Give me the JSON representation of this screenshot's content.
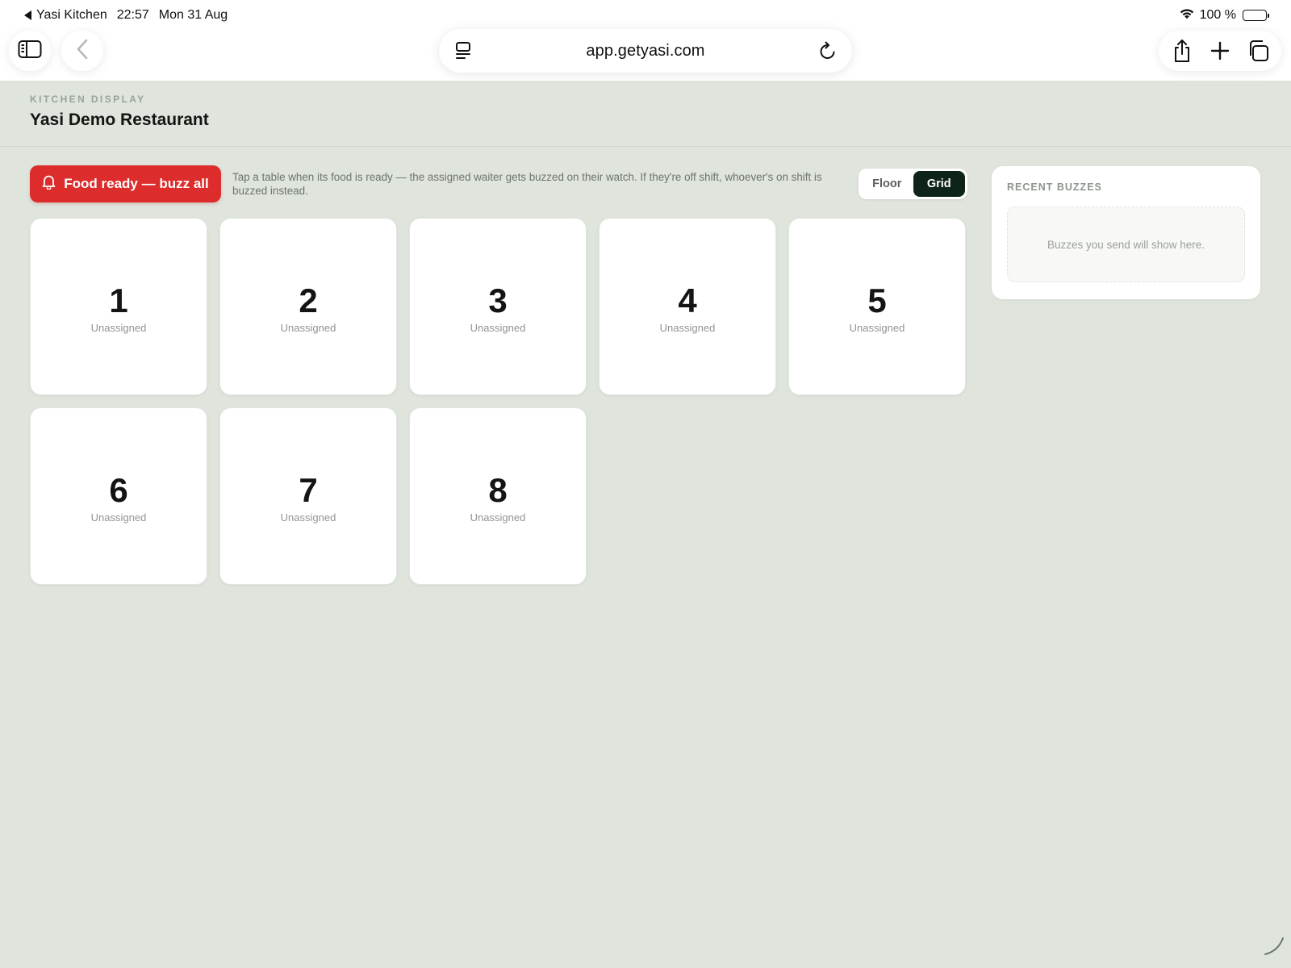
{
  "status_bar": {
    "back_app": "Yasi Kitchen",
    "time": "22:57",
    "date": "Mon 31 Aug",
    "battery": "100 %",
    "battery_level": 1.0
  },
  "browser": {
    "url": "app.getyasi.com",
    "icons": {
      "sidebar": "sidebar-icon",
      "back": "chevron-left-icon",
      "reader": "reader-icon",
      "reload": "reload-icon",
      "share": "share-icon",
      "new_tab": "plus-icon",
      "tabs": "tabs-icon"
    }
  },
  "header": {
    "eyebrow": "KITCHEN DISPLAY",
    "title": "Yasi Demo Restaurant"
  },
  "toolbar": {
    "buzz_all_label": "Food ready — buzz all",
    "buzz_icon": "bell-icon",
    "hint": "Tap a table when its food is ready — the assigned waiter gets buzzed on their watch. If they're off shift, whoever's on shift is buzzed instead.",
    "view_options": [
      {
        "label": "Floor",
        "active": false
      },
      {
        "label": "Grid",
        "active": true
      }
    ]
  },
  "tables": [
    {
      "number": "1",
      "waiter": "Unassigned"
    },
    {
      "number": "2",
      "waiter": "Unassigned"
    },
    {
      "number": "3",
      "waiter": "Unassigned"
    },
    {
      "number": "4",
      "waiter": "Unassigned"
    },
    {
      "number": "5",
      "waiter": "Unassigned"
    },
    {
      "number": "6",
      "waiter": "Unassigned"
    },
    {
      "number": "7",
      "waiter": "Unassigned"
    },
    {
      "number": "8",
      "waiter": "Unassigned"
    }
  ],
  "recent_buzzes": {
    "title": "RECENT BUZZES",
    "empty_text": "Buzzes you send will show here."
  },
  "colors": {
    "page_bg": "#dfe4dd",
    "accent_red": "#dd2c2c",
    "toggle_active": "#0f2418"
  }
}
